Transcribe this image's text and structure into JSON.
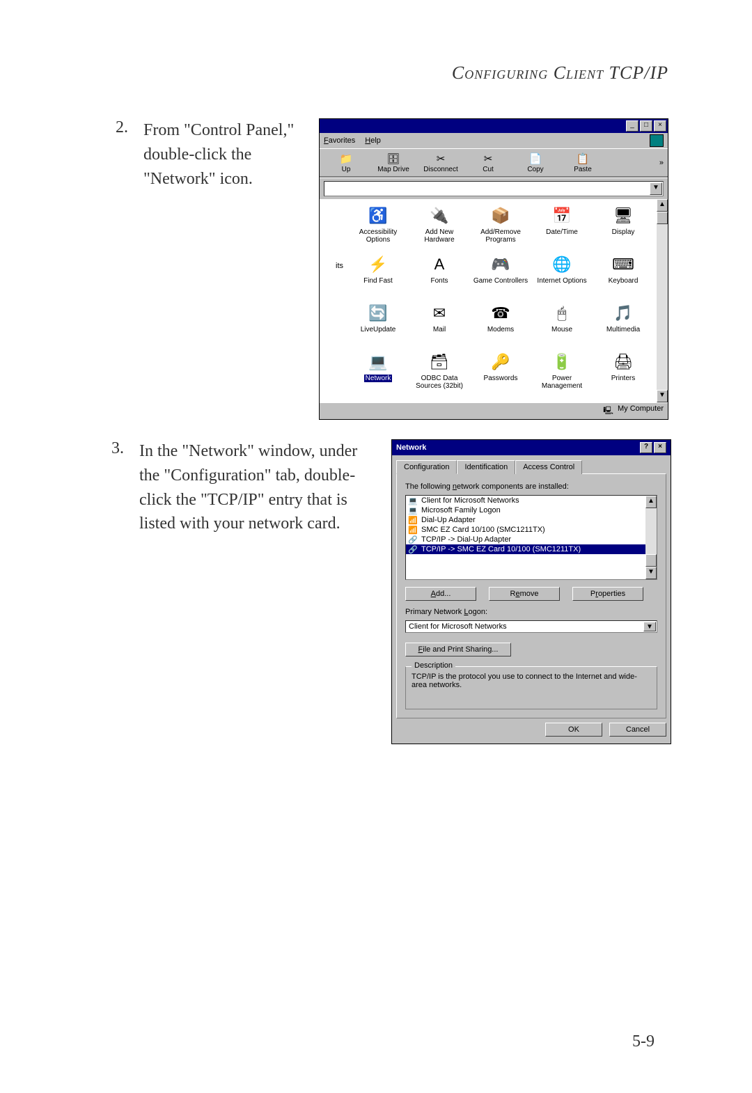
{
  "header": "Configuring Client TCP/IP",
  "page_number": "5-9",
  "steps": {
    "s2": {
      "num": "2.",
      "text": "From \"Control Panel,\" double-click the \"Network\" icon."
    },
    "s3": {
      "num": "3.",
      "text": "In the \"Network\" window, under the \"Configuration\" tab, double-click the \"TCP/IP\" entry that is listed with your network card."
    }
  },
  "control_panel": {
    "menu": {
      "favorites": "Favorites",
      "help": "Help"
    },
    "toolbar": [
      {
        "label": "Up",
        "glyph": "📁"
      },
      {
        "label": "Map Drive",
        "glyph": "🗄"
      },
      {
        "label": "Disconnect",
        "glyph": "✂"
      },
      {
        "label": "Cut",
        "glyph": "✂"
      },
      {
        "label": "Copy",
        "glyph": "📄"
      },
      {
        "label": "Paste",
        "glyph": "📋"
      }
    ],
    "left_text": "its",
    "icons": [
      {
        "label": "Accessibility Options",
        "glyph": "♿",
        "selected": false
      },
      {
        "label": "Add New Hardware",
        "glyph": "🔌",
        "selected": false
      },
      {
        "label": "Add/Remove Programs",
        "glyph": "📦",
        "selected": false
      },
      {
        "label": "Date/Time",
        "glyph": "📅",
        "selected": false
      },
      {
        "label": "Display",
        "glyph": "🖥",
        "selected": false
      },
      {
        "label": "Find Fast",
        "glyph": "⚡",
        "selected": false
      },
      {
        "label": "Fonts",
        "glyph": "A",
        "selected": false
      },
      {
        "label": "Game Controllers",
        "glyph": "🎮",
        "selected": false
      },
      {
        "label": "Internet Options",
        "glyph": "🌐",
        "selected": false
      },
      {
        "label": "Keyboard",
        "glyph": "⌨",
        "selected": false
      },
      {
        "label": "LiveUpdate",
        "glyph": "🔄",
        "selected": false
      },
      {
        "label": "Mail",
        "glyph": "✉",
        "selected": false
      },
      {
        "label": "Modems",
        "glyph": "☎",
        "selected": false
      },
      {
        "label": "Mouse",
        "glyph": "🖱",
        "selected": false
      },
      {
        "label": "Multimedia",
        "glyph": "🎵",
        "selected": false
      },
      {
        "label": "Network",
        "glyph": "💻",
        "selected": true
      },
      {
        "label": "ODBC Data Sources (32bit)",
        "glyph": "🗃",
        "selected": false
      },
      {
        "label": "Passwords",
        "glyph": "🔑",
        "selected": false
      },
      {
        "label": "Power Management",
        "glyph": "🔋",
        "selected": false
      },
      {
        "label": "Printers",
        "glyph": "🖨",
        "selected": false
      }
    ],
    "status": "My Computer"
  },
  "network_dialog": {
    "title": "Network",
    "tabs": {
      "t1": "Configuration",
      "t2": "Identification",
      "t3": "Access Control"
    },
    "components_label": "The following network components are installed:",
    "components": [
      {
        "label": "Client for Microsoft Networks",
        "glyph": "💻",
        "selected": false
      },
      {
        "label": "Microsoft Family Logon",
        "glyph": "💻",
        "selected": false
      },
      {
        "label": "Dial-Up Adapter",
        "glyph": "📶",
        "selected": false
      },
      {
        "label": "SMC EZ Card 10/100 (SMC1211TX)",
        "glyph": "📶",
        "selected": false
      },
      {
        "label": "TCP/IP -> Dial-Up Adapter",
        "glyph": "🔗",
        "selected": false
      },
      {
        "label": "TCP/IP -> SMC EZ Card 10/100 (SMC1211TX)",
        "glyph": "🔗",
        "selected": true
      }
    ],
    "buttons": {
      "add": "Add...",
      "remove": "Remove",
      "properties": "Properties"
    },
    "logon_label": "Primary Network Logon:",
    "logon_value": "Client for Microsoft Networks",
    "fps": "File and Print Sharing...",
    "desc_legend": "Description",
    "desc_text": "TCP/IP is the protocol you use to connect to the Internet and wide-area networks.",
    "ok": "OK",
    "cancel": "Cancel"
  }
}
